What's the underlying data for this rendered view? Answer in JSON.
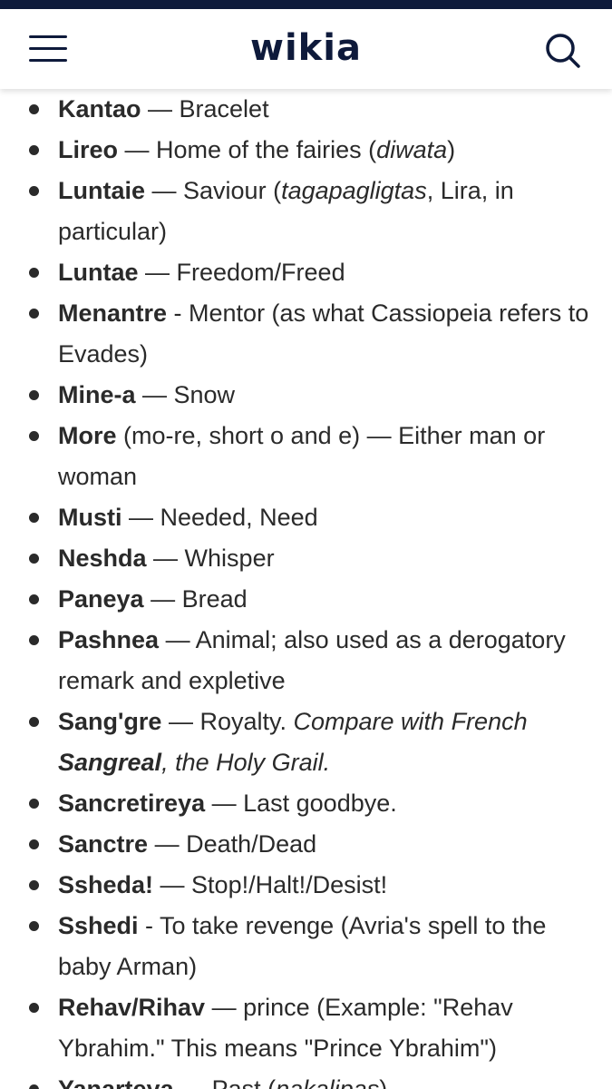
{
  "header": {
    "logo_text": "wikia",
    "menu_icon": "hamburger-menu-icon",
    "search_icon": "search-icon"
  },
  "colors": {
    "brand": "#0e1a3b",
    "text": "#2a2a2a",
    "background": "#ffffff"
  },
  "terms": [
    {
      "term": "Kantao",
      "def": [
        {
          "t": " — Bracelet"
        }
      ]
    },
    {
      "term": "Lireo",
      "def": [
        {
          "t": " — Home of the fairies ("
        },
        {
          "t": "diwata",
          "i": true
        },
        {
          "t": ")"
        }
      ]
    },
    {
      "term": "Luntaie",
      "def": [
        {
          "t": " — Saviour ("
        },
        {
          "t": "tagapagligtas",
          "i": true
        },
        {
          "t": ", Lira, in particular)"
        }
      ]
    },
    {
      "term": "Luntae",
      "def": [
        {
          "t": " — Freedom/Freed"
        }
      ]
    },
    {
      "term": "Menantre",
      "def": [
        {
          "t": " - Mentor (as what Cassiopeia refers to Evades)"
        }
      ]
    },
    {
      "term": "Mine-a",
      "def": [
        {
          "t": " — Snow"
        }
      ]
    },
    {
      "term": "More",
      "def": [
        {
          "t": " (mo-re, short o and e) — Either man or woman"
        }
      ]
    },
    {
      "term": "Musti",
      "def": [
        {
          "t": " — Needed, Need"
        }
      ]
    },
    {
      "term": "Neshda",
      "def": [
        {
          "t": " — Whisper"
        }
      ]
    },
    {
      "term": "Paneya",
      "def": [
        {
          "t": " — Bread"
        }
      ]
    },
    {
      "term": "Pashnea",
      "def": [
        {
          "t": " — Animal; also used as a derogatory remark and expletive"
        }
      ]
    },
    {
      "term": "Sang'gre",
      "def": [
        {
          "t": " — Royalty. "
        },
        {
          "t": "Compare with French ",
          "i": true
        },
        {
          "t": "Sangreal",
          "i": true,
          "b": true
        },
        {
          "t": ", the Holy Grail.",
          "i": true
        }
      ]
    },
    {
      "term": "Sancretireya",
      "def": [
        {
          "t": " — Last goodbye."
        }
      ]
    },
    {
      "term": "Sanctre",
      "def": [
        {
          "t": " — Death/Dead"
        }
      ]
    },
    {
      "term": "Ssheda!",
      "def": [
        {
          "t": " — Stop!/Halt!/Desist!"
        }
      ]
    },
    {
      "term": "Sshedi",
      "def": [
        {
          "t": " - To take revenge (Avria's spell to the baby Arman)"
        }
      ]
    },
    {
      "term": "Rehav/Rihav",
      "def": [
        {
          "t": " — prince (Example: \"Rehav Ybrahim.\" This means \"Prince Ybrahim\")"
        }
      ]
    },
    {
      "term": "Yanarteya",
      "def": [
        {
          "t": " — Past ("
        },
        {
          "t": "nakalipas",
          "i": true
        },
        {
          "t": ")"
        }
      ]
    }
  ]
}
